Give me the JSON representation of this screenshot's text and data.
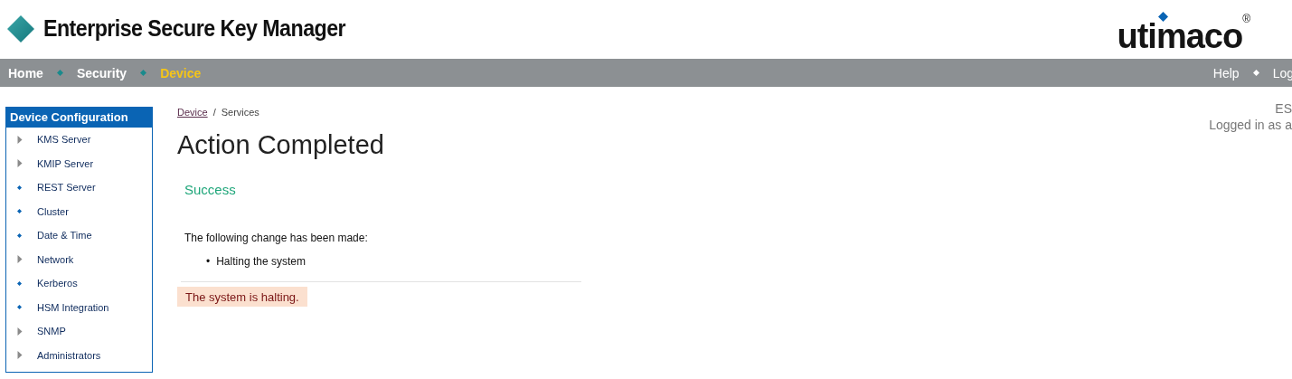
{
  "header": {
    "title": "Enterprise Secure Key Manager",
    "logo": "utimaco",
    "logo_mark": "®"
  },
  "nav": {
    "left": [
      {
        "label": "Home",
        "selected": false
      },
      {
        "label": "Security",
        "selected": false
      },
      {
        "label": "Device",
        "selected": true
      }
    ],
    "right": [
      "Help",
      "Log"
    ]
  },
  "sidebar": {
    "title": "Device Configuration",
    "items": [
      {
        "label": "KMS Server",
        "kind": "group"
      },
      {
        "label": "KMIP Server",
        "kind": "group"
      },
      {
        "label": "REST Server",
        "kind": "link"
      },
      {
        "label": "Cluster",
        "kind": "link"
      },
      {
        "label": "Date & Time",
        "kind": "link"
      },
      {
        "label": "Network",
        "kind": "group"
      },
      {
        "label": "Kerberos",
        "kind": "link"
      },
      {
        "label": "HSM Integration",
        "kind": "link"
      },
      {
        "label": "SNMP",
        "kind": "group"
      },
      {
        "label": "Administrators",
        "kind": "group"
      }
    ]
  },
  "breadcrumb": {
    "link": "Device",
    "separator": "/",
    "current": "Services"
  },
  "content": {
    "heading": "Action Completed",
    "status": "Success",
    "intro": "The following change has been made:",
    "changes": [
      {
        "bullet": "•",
        "text": "Halting the system"
      }
    ],
    "alert": "The system is halting."
  },
  "session": {
    "line_1": "ES",
    "line_2": "Logged in as a"
  }
}
